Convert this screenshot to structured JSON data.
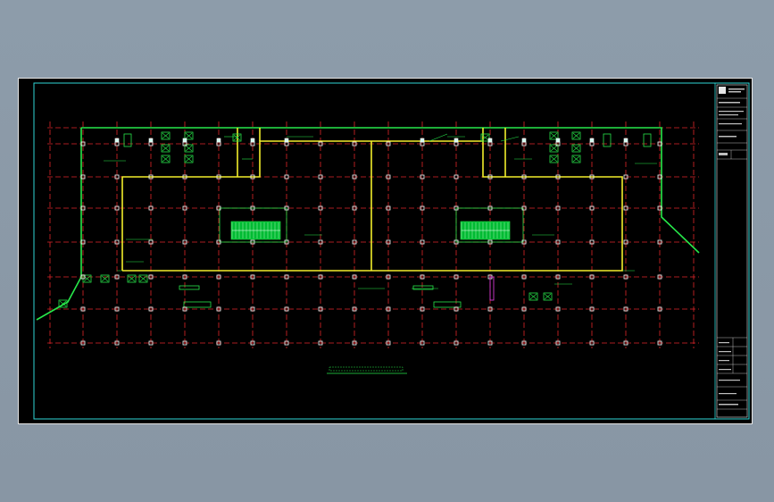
{
  "drawing": {
    "title_caption": "",
    "title_block_rows": [
      "",
      "",
      "",
      "",
      "",
      "",
      ""
    ]
  },
  "colors": {
    "background": "#000000",
    "border_cyan": "#2fd6d6",
    "wall_green": "#27e84a",
    "axis_red": "#e0262a",
    "partition_yellow": "#f2ee2a",
    "column_white": "#ffffff",
    "annotation_magenta": "#d63ad6",
    "viewer_bg": "#8b9aa8"
  },
  "icons": {
    "column": "column-marker-icon",
    "equipment": "equipment-box-icon",
    "stair": "stair-symbol-icon"
  }
}
